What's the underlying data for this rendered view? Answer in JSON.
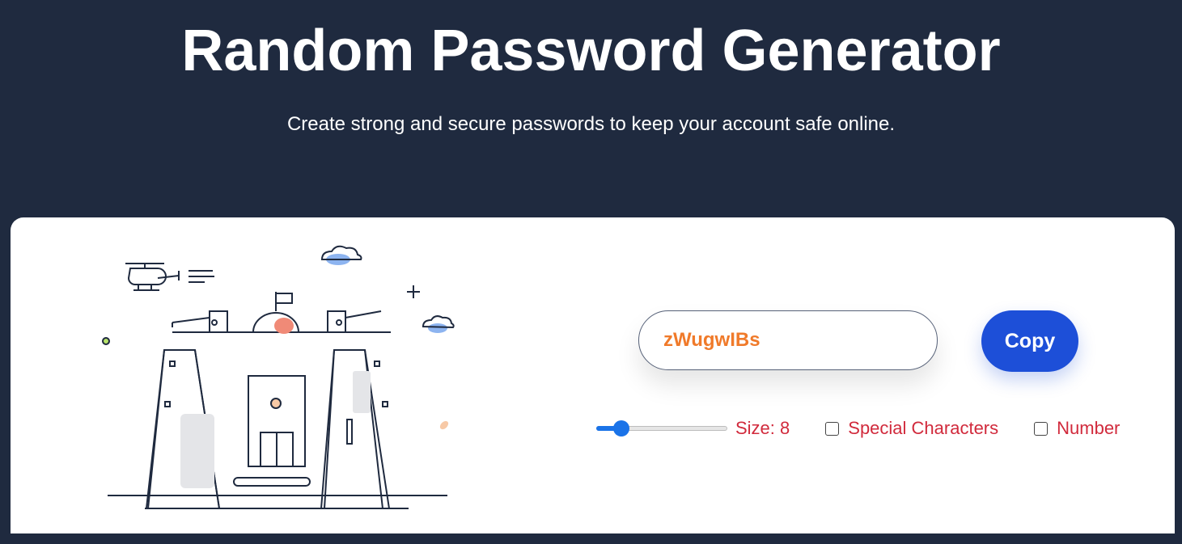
{
  "header": {
    "title": "Random Password Generator",
    "subtitle": "Create strong and secure passwords to keep your account safe online."
  },
  "password": {
    "value": "zWugwIBs"
  },
  "copy_button": {
    "label": "Copy"
  },
  "size_control": {
    "label": "Size: 8",
    "value": 8,
    "fraction": 0.19
  },
  "options": [
    {
      "label": "Special Characters",
      "checked": false
    },
    {
      "label": "Number",
      "checked": false
    }
  ],
  "colors": {
    "background": "#1f2a3f",
    "card": "#ffffff",
    "accent": "#1d4fd8",
    "password_text": "#f07a2a",
    "control_text": "#d12a3c",
    "slider": "#1a73e8"
  },
  "icons": {
    "illustration": "castle-illustration"
  }
}
